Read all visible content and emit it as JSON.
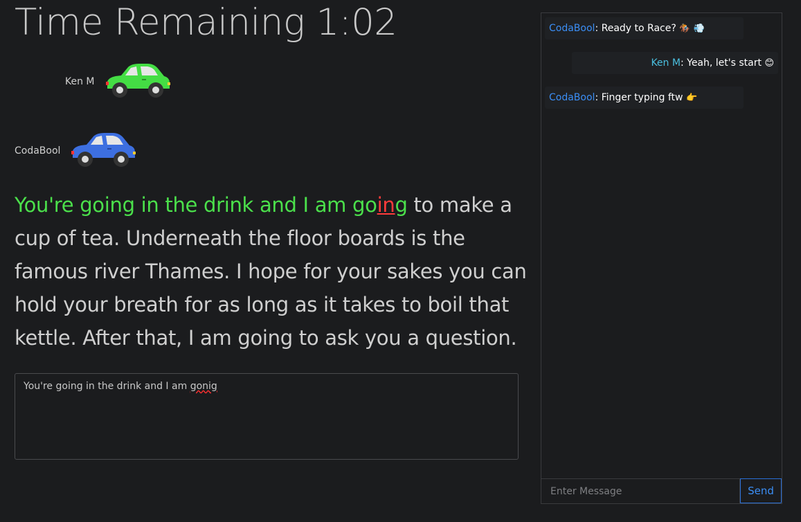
{
  "timer": {
    "label": "Time Remaining 1:02"
  },
  "racers": [
    {
      "name": "Ken M",
      "car_color": "#44dd44"
    },
    {
      "name": "CodaBool",
      "car_color": "#3d6fe0"
    }
  ],
  "passage": {
    "typed_correct": "You're going in the drink and I am go",
    "typed_error": "in",
    "typed_after": "g",
    "remaining": " to make a cup of tea. Underneath the floor boards is the famous river Thames. I hope for your sakes you can hold your breath for as long as it takes to boil that kettle. After that, I am going to ask you a question."
  },
  "input": {
    "text_before": "You're going in the drink and I am ",
    "text_misspelled": "gonig"
  },
  "chat": {
    "messages": [
      {
        "author": "CodaBool",
        "text": "Ready to Race?",
        "emoji": "🏇 💨"
      },
      {
        "author": "Ken M",
        "text": "Yeah, let's start",
        "emoji": "😊"
      },
      {
        "author": "CodaBool",
        "text": "Finger typing ftw",
        "emoji": "👉"
      }
    ],
    "input_placeholder": "Enter Message",
    "send_label": "Send"
  },
  "colors": {
    "correct": "#4be04b",
    "error": "#ff3b3b",
    "accent": "#3b8ef5"
  }
}
